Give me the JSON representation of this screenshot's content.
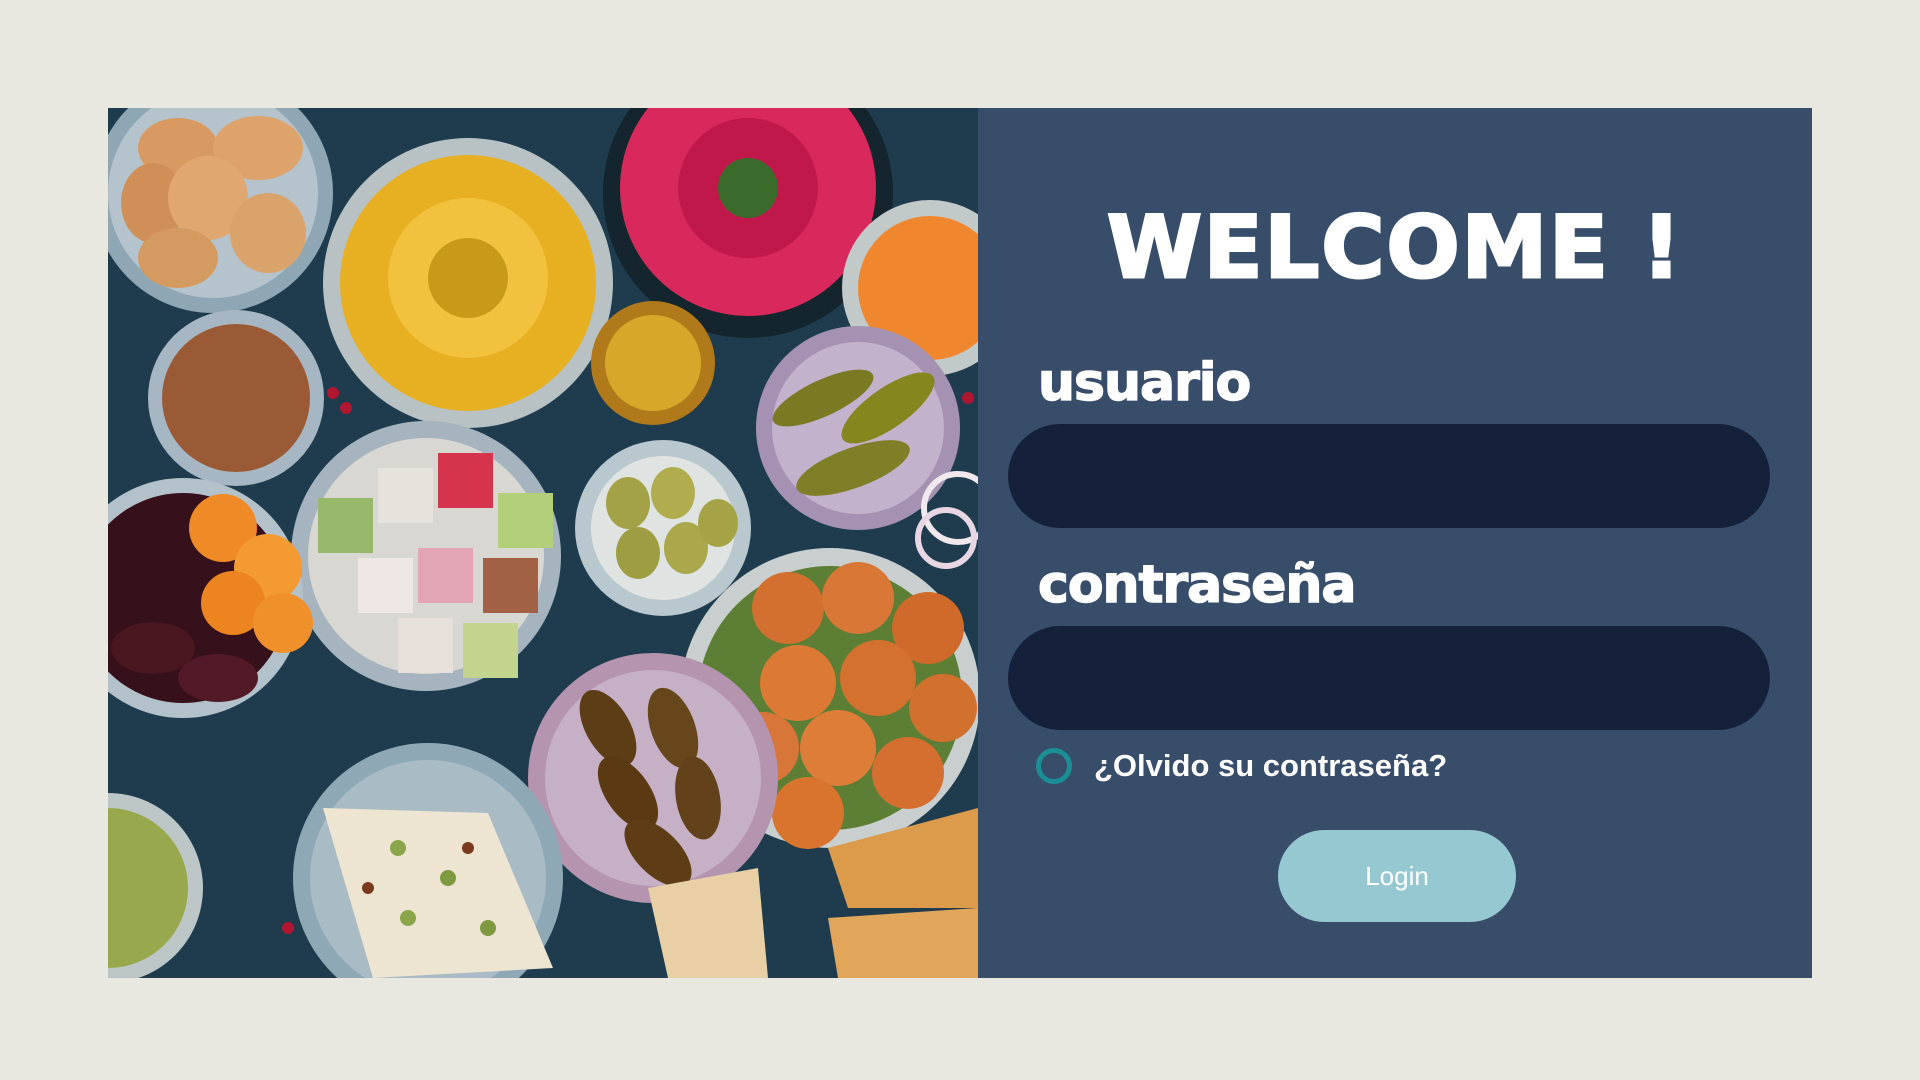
{
  "photo": {
    "alt": "mezze spread"
  },
  "login": {
    "heading": "WELCOME !",
    "user_label": "usuario",
    "user_value": "",
    "password_label": "contraseña",
    "password_value": "",
    "forgot_label": "¿Olvido su contraseña?",
    "button_label": "Login"
  },
  "colors": {
    "page_bg": "#e8e7e0",
    "panel_bg": "#374d69",
    "field_bg": "#15213a",
    "radio_ring": "#1a8f95",
    "button_bg": "#96c8d2"
  }
}
